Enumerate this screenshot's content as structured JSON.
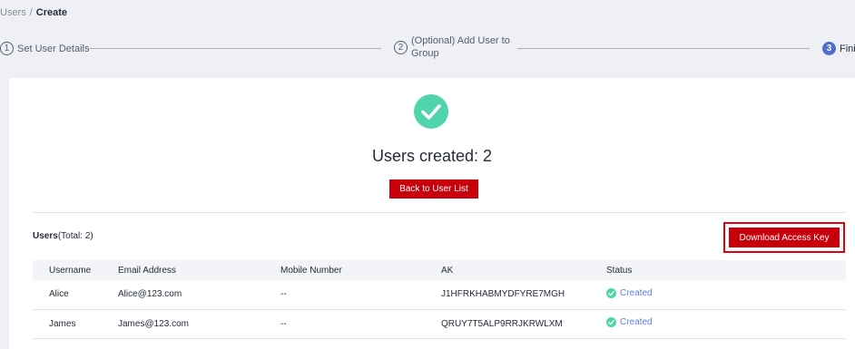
{
  "breadcrumb": {
    "parent": "Users",
    "separator": "/",
    "current": "Create"
  },
  "stepper": {
    "steps": [
      {
        "number": "1",
        "label": "Set User Details"
      },
      {
        "number": "2",
        "label_line1": "(Optional) Add User to",
        "label_line2": "Group"
      },
      {
        "number": "3",
        "label": "Finish"
      }
    ]
  },
  "result": {
    "title": "Users created: 2",
    "back_button": "Back to User List"
  },
  "users_section": {
    "label_bold": "Users",
    "label_total": "(Total: 2)",
    "download_button": "Download Access Key"
  },
  "table": {
    "headers": [
      "Username",
      "Email Address",
      "Mobile Number",
      "AK",
      "Status"
    ],
    "rows": [
      {
        "username": "Alice",
        "email": "Alice@123.com",
        "mobile": "--",
        "ak": "J1HFRKHABMYDFYRE7MGH",
        "status": "Created"
      },
      {
        "username": "James",
        "email": "James@123.com",
        "mobile": "--",
        "ak": "QRUY7T5ALP9RRJKRWLXM",
        "status": "Created"
      }
    ]
  },
  "colors": {
    "brand_red": "#c7000b",
    "success_green": "#50d4ab",
    "active_step": "#526ecc"
  },
  "icons": {
    "success": "check-circle-icon",
    "status": "check-circle-icon"
  }
}
